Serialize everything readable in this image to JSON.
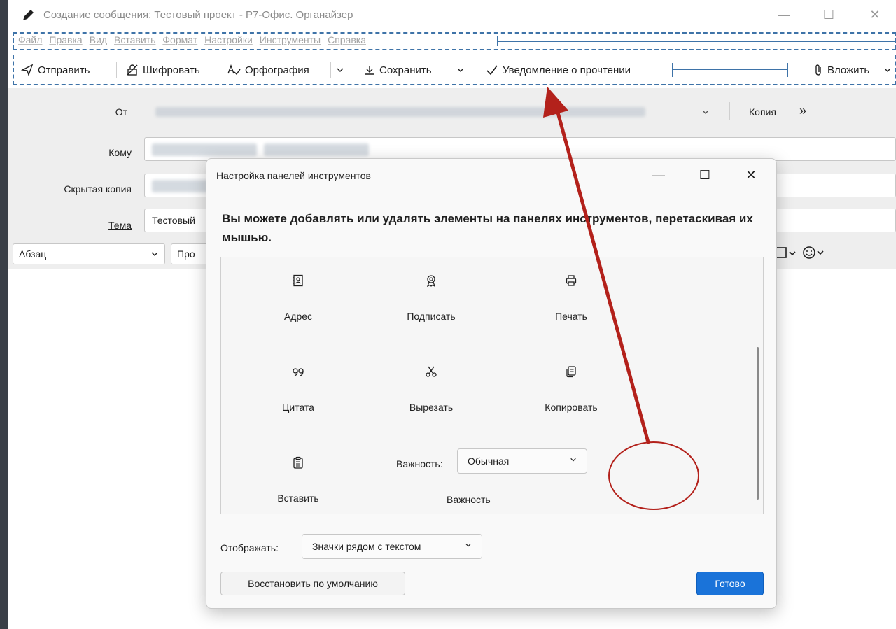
{
  "window": {
    "title": "Создание сообщения: Тестовый проект - Р7-Офис. Органайзер",
    "controls": {
      "minimize": "—",
      "maximize": "☐",
      "close": "✕"
    }
  },
  "menu": {
    "items": [
      {
        "label": "Файл"
      },
      {
        "label": "Правка"
      },
      {
        "label": "Вид"
      },
      {
        "label": "Вставить"
      },
      {
        "label": "Формат"
      },
      {
        "label": "Настройки"
      },
      {
        "label": "Инструменты"
      },
      {
        "label": "Справка"
      }
    ]
  },
  "toolbar": {
    "send": "Отправить",
    "encrypt": "Шифровать",
    "spelling": "Орфография",
    "save": "Сохранить",
    "read_receipt": "Уведомление о прочтении",
    "attach": "Вложить"
  },
  "form": {
    "from_label": "От",
    "cc_link": "Копия",
    "more_link": "»",
    "to_label": "Кому",
    "bcc_label": "Скрытая копия",
    "subject_label": "Тема",
    "subject_value": "Тестовый"
  },
  "format_bar": {
    "paragraph": "Абзац",
    "font_partial": "Про"
  },
  "dialog": {
    "title": "Настройка панелей инструментов",
    "controls": {
      "minimize": "—",
      "maximize": "☐",
      "close": "✕"
    },
    "heading": "Вы можете добавлять или удалять элементы на панелях инструментов, перетаскивая их мышью.",
    "items": [
      {
        "label": "Адрес",
        "icon": "address-book-icon"
      },
      {
        "label": "Подписать",
        "icon": "sign-icon"
      },
      {
        "label": "Печать",
        "icon": "print-icon"
      },
      {
        "label": "Цитата",
        "icon": "quote-icon"
      },
      {
        "label": "Вырезать",
        "icon": "cut-icon"
      },
      {
        "label": "Копировать",
        "icon": "copy-icon"
      },
      {
        "label": "Вставить",
        "icon": "paste-icon"
      }
    ],
    "importance": {
      "field_label": "Важность:",
      "value": "Обычная",
      "item_label": "Важность"
    },
    "show_label": "Отображать:",
    "show_value": "Значки рядом с текстом",
    "reset_button": "Восстановить по умолчанию",
    "done_button": "Готово"
  },
  "colors": {
    "accent": "#1a73d9",
    "dashed_outline": "#3e73a8",
    "annotation": "#b3211b"
  }
}
